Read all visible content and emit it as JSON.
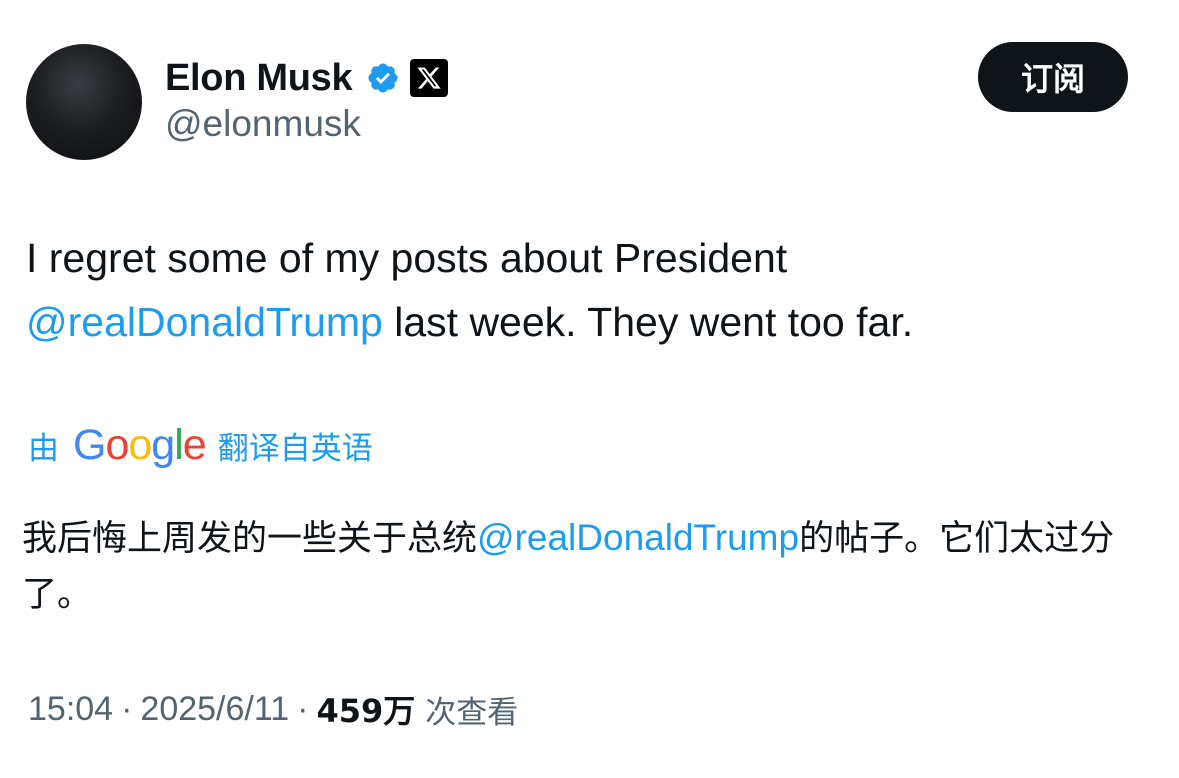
{
  "author": {
    "display_name": "Elon Musk",
    "handle": "@elonmusk",
    "verified_color": "#1d9bf0",
    "badge_icon": "x-logo-icon"
  },
  "subscribe_label": "订阅",
  "tweet": {
    "text_part1": "I regret some of my posts about President",
    "mention": "@realDonaldTrump",
    "text_part2": " last week. They went too far."
  },
  "translation": {
    "by_label": "由",
    "provider_letters": [
      "G",
      "o",
      "o",
      "g",
      "l",
      "e"
    ],
    "from_label": "翻译自英语",
    "text_part1": "我后悔上周发的一些关于总统",
    "mention": "@realDonaldTrump",
    "text_part2": "的帖子。它们太过分了。"
  },
  "meta": {
    "time": "15:04",
    "date": "2025/6/11",
    "views": "459万",
    "views_label": "次查看"
  },
  "colors": {
    "accent": "#1d9bf0",
    "text": "#0f1419",
    "secondary": "#536471"
  }
}
